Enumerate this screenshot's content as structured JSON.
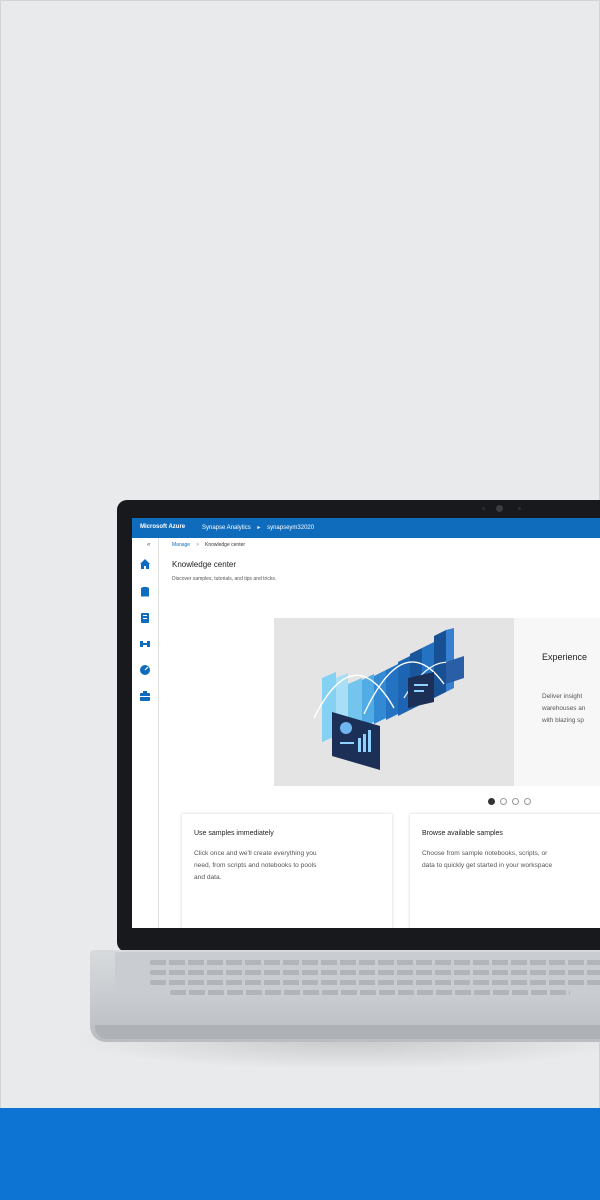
{
  "portal": {
    "brand": "Microsoft Azure",
    "breadcrumb": [
      "Synapse Analytics",
      "▸",
      "synapseym32020"
    ]
  },
  "page": {
    "crumb_link": "Manage",
    "crumb_separator": ">",
    "crumb_current": "Knowledge center",
    "collapse_icon": "«",
    "title": "Knowledge center",
    "subtitle": "Discover samples, tutorials, and tips and tricks."
  },
  "sidebar": {
    "icons": [
      "home-icon",
      "data-icon",
      "develop-icon",
      "integrate-icon",
      "monitor-icon",
      "manage-icon"
    ]
  },
  "hero": {
    "title": "Experience",
    "body": "Deliver insight\nwarehouses an\nwith blazing sp",
    "carousel_count": 4,
    "carousel_active": 0
  },
  "cards": [
    {
      "title": "Use samples immediately",
      "body": "Click once and we'll create everything you\nneed, from scripts and notebooks to pools\nand data."
    },
    {
      "title": "Browse available samples",
      "body": "Choose from sample notebooks, scripts, or\ndata to quickly get started in your workspace"
    }
  ],
  "colors": {
    "accent": "#0f6cbd",
    "band": "#0d74d4",
    "background": "#e9eaeb"
  }
}
